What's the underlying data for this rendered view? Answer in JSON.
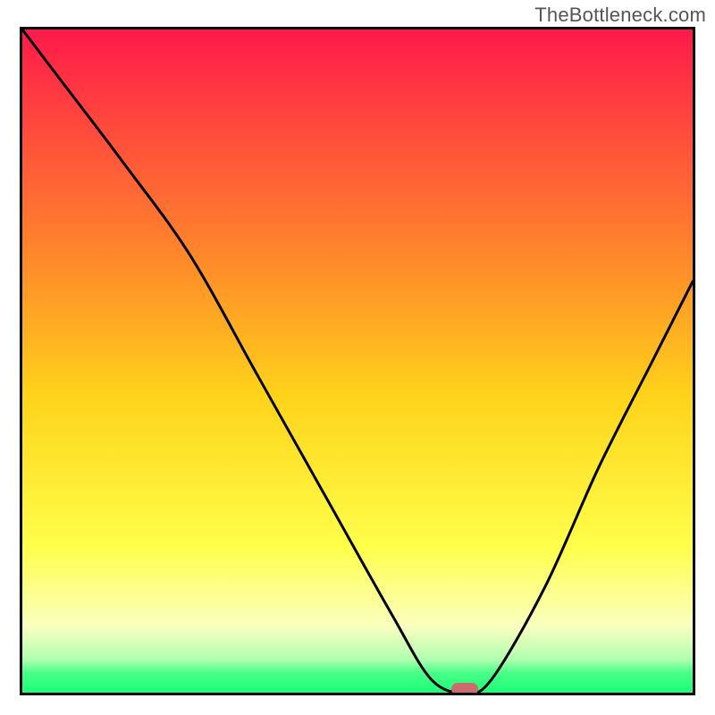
{
  "watermark": "TheBottleneck.com",
  "colors": {
    "border": "#000000",
    "marker": "#cc6a70",
    "gradient_stops": [
      {
        "offset": 0.0,
        "color": "#ff1a4a"
      },
      {
        "offset": 0.35,
        "color": "#ff8a2a"
      },
      {
        "offset": 0.55,
        "color": "#ffd21a"
      },
      {
        "offset": 0.78,
        "color": "#ffff4a"
      },
      {
        "offset": 0.9,
        "color": "#faffbf"
      },
      {
        "offset": 0.95,
        "color": "#b0ffb0"
      },
      {
        "offset": 0.97,
        "color": "#4aff89"
      },
      {
        "offset": 1.0,
        "color": "#1aff77"
      }
    ]
  },
  "chart_data": {
    "type": "line",
    "title": "",
    "xlabel": "",
    "ylabel": "",
    "xlim": [
      0,
      100
    ],
    "ylim": [
      0,
      100
    ],
    "legend": false,
    "x": [
      0,
      6,
      15,
      25,
      35,
      45,
      55,
      61,
      66,
      70,
      78,
      86,
      94,
      100
    ],
    "values": [
      100,
      92,
      80,
      66,
      48,
      30,
      12,
      2,
      0,
      2,
      16,
      34,
      50,
      62
    ],
    "marker": {
      "x": 66,
      "y": 0
    },
    "annotations": []
  }
}
